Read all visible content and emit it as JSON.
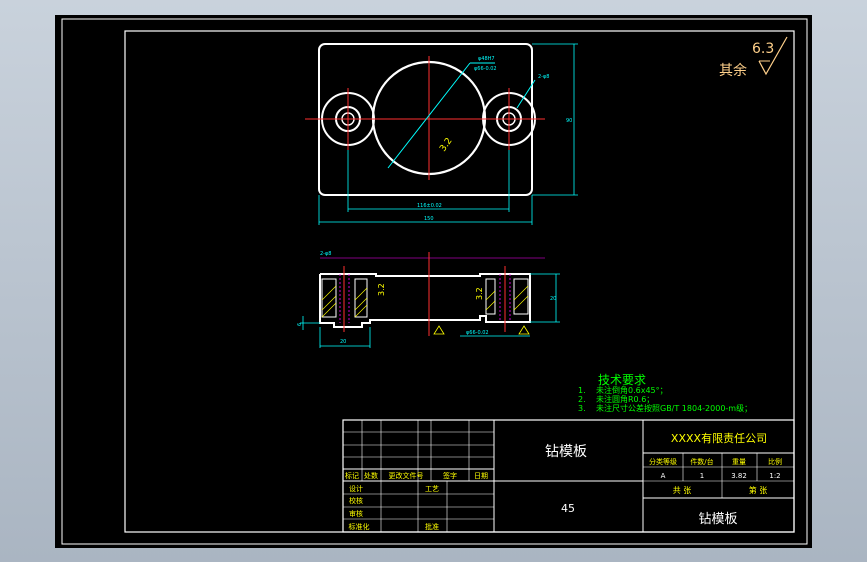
{
  "roughness": {
    "value": "6.3",
    "label": "其余"
  },
  "tech_req": {
    "title": "技术要求",
    "items": [
      {
        "num": "1.",
        "text": "未注倒角0.6x45°；"
      },
      {
        "num": "2.",
        "text": "未注圆角R0.6；"
      },
      {
        "num": "3.",
        "text": "未注尺寸公差按照GB/T 1804-2000-m级；"
      }
    ]
  },
  "title_block": {
    "part_name": "钻模板",
    "material": "45",
    "company": "XXXX有限责任公司",
    "part_name_bottom": "钻模板",
    "headers": {
      "stage": "分类等级",
      "mark": "件数/台",
      "weight": "重量",
      "scale": "比例"
    },
    "values": {
      "stage": "A",
      "mark": "1",
      "weight": "3.82",
      "scale": "1:2"
    },
    "sheet": {
      "total": "共 张",
      "num": "第 张"
    },
    "rev_headers": [
      "标记",
      "处数",
      "更改文件号",
      "签字",
      "日期"
    ],
    "roles": {
      "designer": "设计",
      "checker": "校核",
      "reviewer": "审核",
      "approver": "标准化",
      "process": "工艺",
      "approve": "批准"
    }
  },
  "colors": {
    "background": "#000000",
    "line": "#ffffff",
    "center": "#ff0000",
    "dim": "#00ffff",
    "leader": "#ff00ff",
    "yellow": "#ffff00",
    "green": "#00ff00",
    "orange": "#ffd08a"
  }
}
